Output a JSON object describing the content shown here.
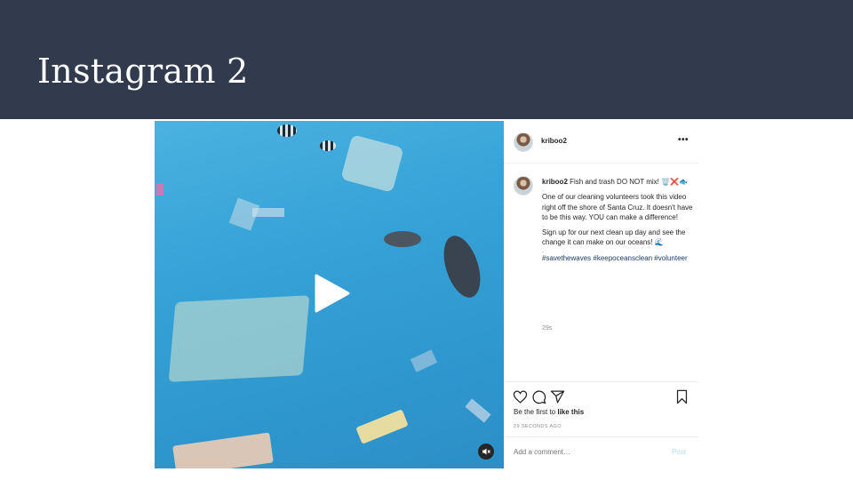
{
  "slide": {
    "title": "Instagram 2"
  },
  "post": {
    "username": "kriboo2",
    "more_label": "•••",
    "caption": {
      "username": "kriboo2",
      "line1": " Fish and trash DO NOT mix! 🗑️❌🐟",
      "dot1": ".",
      "paragraph1": "One of our cleaning volunteers took this video right off the shore of Santa Cruz. It doesn't have to be this way. YOU can make a difference!",
      "dot2": ".",
      "paragraph2": "Sign up for our next clean up day and see the change it can make on our oceans! 🌊",
      "dot3": ".",
      "hashtags": "#savethewaves #keepoceansclean #volunteer"
    },
    "time_short": "29s",
    "likes_prefix": "Be the first to ",
    "likes_action": "like this",
    "time_ago": "29 SECONDS AGO",
    "comment_placeholder": "Add a comment…",
    "post_button": "Post"
  },
  "icons": {
    "like": "heart-outline-icon",
    "comment": "speech-bubble-icon",
    "share": "paper-plane-icon",
    "save": "bookmark-icon",
    "play": "play-icon",
    "mute": "speaker-muted-icon"
  },
  "colors": {
    "header_bg": "#323b4d",
    "water": "#37a3d8",
    "hashtag": "#1b3a6b",
    "post_button": "#b3dbff"
  }
}
